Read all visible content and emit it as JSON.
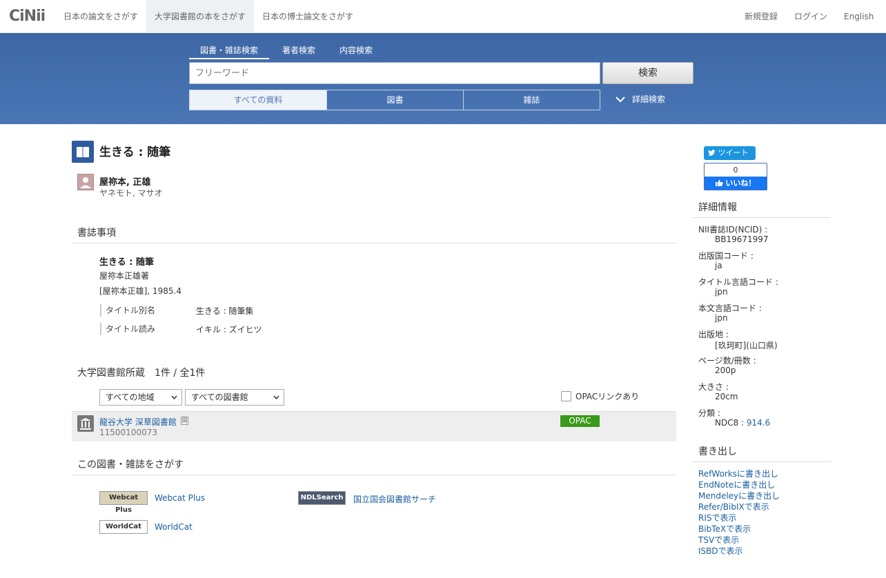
{
  "nav": {
    "logo": "CiNii",
    "items": [
      "日本の論文をさがす",
      "大学図書館の本をさがす",
      "日本の博士論文をさがす"
    ],
    "right": [
      "新規登録",
      "ログイン",
      "English"
    ]
  },
  "search": {
    "tabs": [
      "図書・雑誌検索",
      "著者検索",
      "内容検索"
    ],
    "placeholder": "フリーワード",
    "button": "検索",
    "types": [
      "すべての資料",
      "図書",
      "雑誌"
    ],
    "advanced": "詳細検索"
  },
  "book": {
    "title": "生きる : 随筆",
    "author_name": "屋祢本, 正雄",
    "author_kana": "ヤネモト, マサオ"
  },
  "bib": {
    "heading": "書誌事項",
    "title": "生きる : 随筆",
    "statement": "屋祢本正雄著",
    "publication": "[屋祢本正雄], 1985.4",
    "fields": [
      {
        "label": "タイトル別名",
        "value": "生きる : 随筆集"
      },
      {
        "label": "タイトル読み",
        "value": "イキル : ズイヒツ"
      }
    ]
  },
  "holdings": {
    "heading": "大学図書館所蔵　1件 / 全1件",
    "region_select": "すべての地域",
    "library_select": "すべての図書館",
    "opac_filter": "OPACリンクあり",
    "library": "龍谷大学 深草図書館",
    "badge": "図",
    "code": "11500100073",
    "opac": "OPAC"
  },
  "search_elsewhere": {
    "heading": "この図書・雑誌をさがす",
    "links": [
      {
        "logo": "Webcat Plus",
        "label": "Webcat Plus"
      },
      {
        "logo": "NDLSearch",
        "label": "国立国会図書館サーチ"
      },
      {
        "logo": "WorldCat",
        "label": "WorldCat"
      }
    ]
  },
  "share": {
    "tweet": "ツイート",
    "like_count": "0",
    "like": "いいね！"
  },
  "details": {
    "heading": "詳細情報",
    "items": [
      {
        "label": "NII書誌ID(NCID) :",
        "value": "BB19671997"
      },
      {
        "label": "出版国コード :",
        "value": "ja"
      },
      {
        "label": "タイトル言語コード :",
        "value": "jpn"
      },
      {
        "label": "本文言語コード :",
        "value": "jpn"
      },
      {
        "label": "出版地 :",
        "value": "[玖珂町](山口県)"
      },
      {
        "label": "ページ数/冊数 :",
        "value": "200p"
      },
      {
        "label": "大きさ :",
        "value": "20cm"
      }
    ],
    "classification_label": "分類 :",
    "ndc_prefix": "NDC8 : ",
    "ndc_value": "914.6"
  },
  "export": {
    "heading": "書き出し",
    "links": [
      "RefWorksに書き出し",
      "EndNoteに書き出し",
      "Mendeleyに書き出し",
      "Refer/BibIXで表示",
      "RISで表示",
      "BibTeXで表示",
      "TSVで表示",
      "ISBDで表示"
    ]
  }
}
